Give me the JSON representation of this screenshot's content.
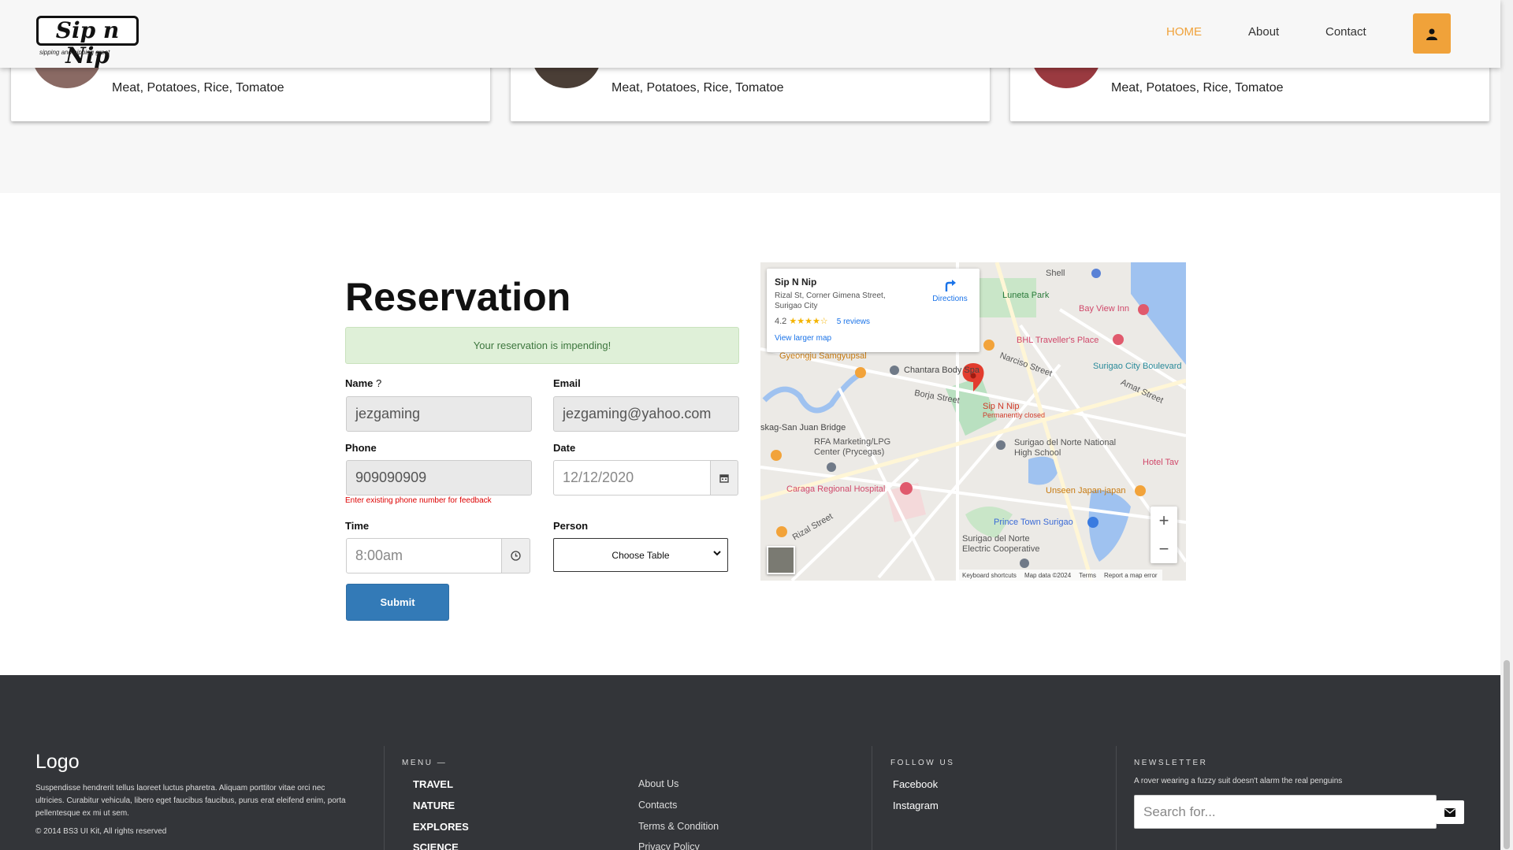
{
  "navbar": {
    "logo_text": "Sip n Nip",
    "logo_tagline": "sipping and nipping great",
    "links": [
      "HOME",
      "About",
      "Contact"
    ]
  },
  "cards": [
    {
      "ingredients": "Meat, Potatoes, Rice, Tomatoe",
      "avatar_color": "#8a6a64"
    },
    {
      "ingredients": "Meat, Potatoes, Rice, Tomatoe",
      "avatar_color": "#4a3e36"
    },
    {
      "ingredients": "Meat, Potatoes, Rice, Tomatoe",
      "avatar_color": "#9a3a40"
    }
  ],
  "reservation": {
    "title": "Reservation",
    "alert": "Your reservation is impending!",
    "name_label": "Name",
    "name_required_mark": "?",
    "name_value": "jezgaming",
    "email_label": "Email",
    "email_value": "jezgaming@yahoo.com",
    "phone_label": "Phone",
    "phone_value": "909090909",
    "phone_help": "Enter existing phone number for feedback",
    "date_label": "Date",
    "date_value": "12/12/2020",
    "time_label": "Time",
    "time_value": "8:00am",
    "person_label": "Person",
    "person_select": "Choose Table",
    "submit_label": "Submit"
  },
  "map": {
    "place_name": "Sip N Nip",
    "address": "Rizal St, Corner Gimena Street, Surigao City",
    "rating": "4.2",
    "stars": "★★★★☆",
    "reviews": "5 reviews",
    "larger_map": "View larger map",
    "directions": "Directions",
    "labels": [
      "Shell",
      "Luneta Park",
      "Bay View Inn",
      "BHL Traveller's Place",
      "Gyeongju Samgyupsal",
      "Chantara Body Spa",
      "Surigao City Boulevard",
      "Narciso Street",
      "Borja Street",
      "Amat Street",
      "Sip N Nip",
      "Permanently closed",
      "skag-San Juan Bridge",
      "RFA Marketing/LPG Center (Prycegas)",
      "Surigao del Norte National High School",
      "Hotel Tav",
      "Caraga Regional Hospital",
      "Unseen Japan-japan",
      "Prince Town Surigao",
      "Surigao del Norte Electric Cooperative",
      "Rizal Street"
    ],
    "footer": [
      "Keyboard shortcuts",
      "Map data ©2024",
      "Terms",
      "Report a map error"
    ]
  },
  "footer": {
    "logo": "Logo",
    "description": "Suspendisse hendrerit tellus laoreet luctus pharetra. Aliquam porttitor vitae orci nec ultricies. Curabitur vehicula, libero eget faucibus faucibus, purus erat eleifend enim, porta pellentesque ex mi ut sem.",
    "copyright": "© 2014 BS3 UI Kit, All rights reserved",
    "menu_heading": "MENU —",
    "menu_primary": [
      "TRAVEL",
      "NATURE",
      "EXPLORES",
      "SCIENCE"
    ],
    "menu_secondary": [
      "About Us",
      "Contacts",
      "Terms & Condition",
      "Privacy Policy"
    ],
    "follow_heading": "FOLLOW US",
    "follow": [
      "Facebook",
      "Instagram"
    ],
    "newsletter_heading": "NEWSLETTER",
    "newsletter_text": "A rover wearing a fuzzy suit doesn't alarm the real penguins",
    "search_placeholder": "Search for..."
  },
  "colors": {
    "accent": "#f0a23a",
    "primary_button": "#337ab7",
    "footer_bg": "#333539",
    "alert_bg": "#dff0d8"
  }
}
